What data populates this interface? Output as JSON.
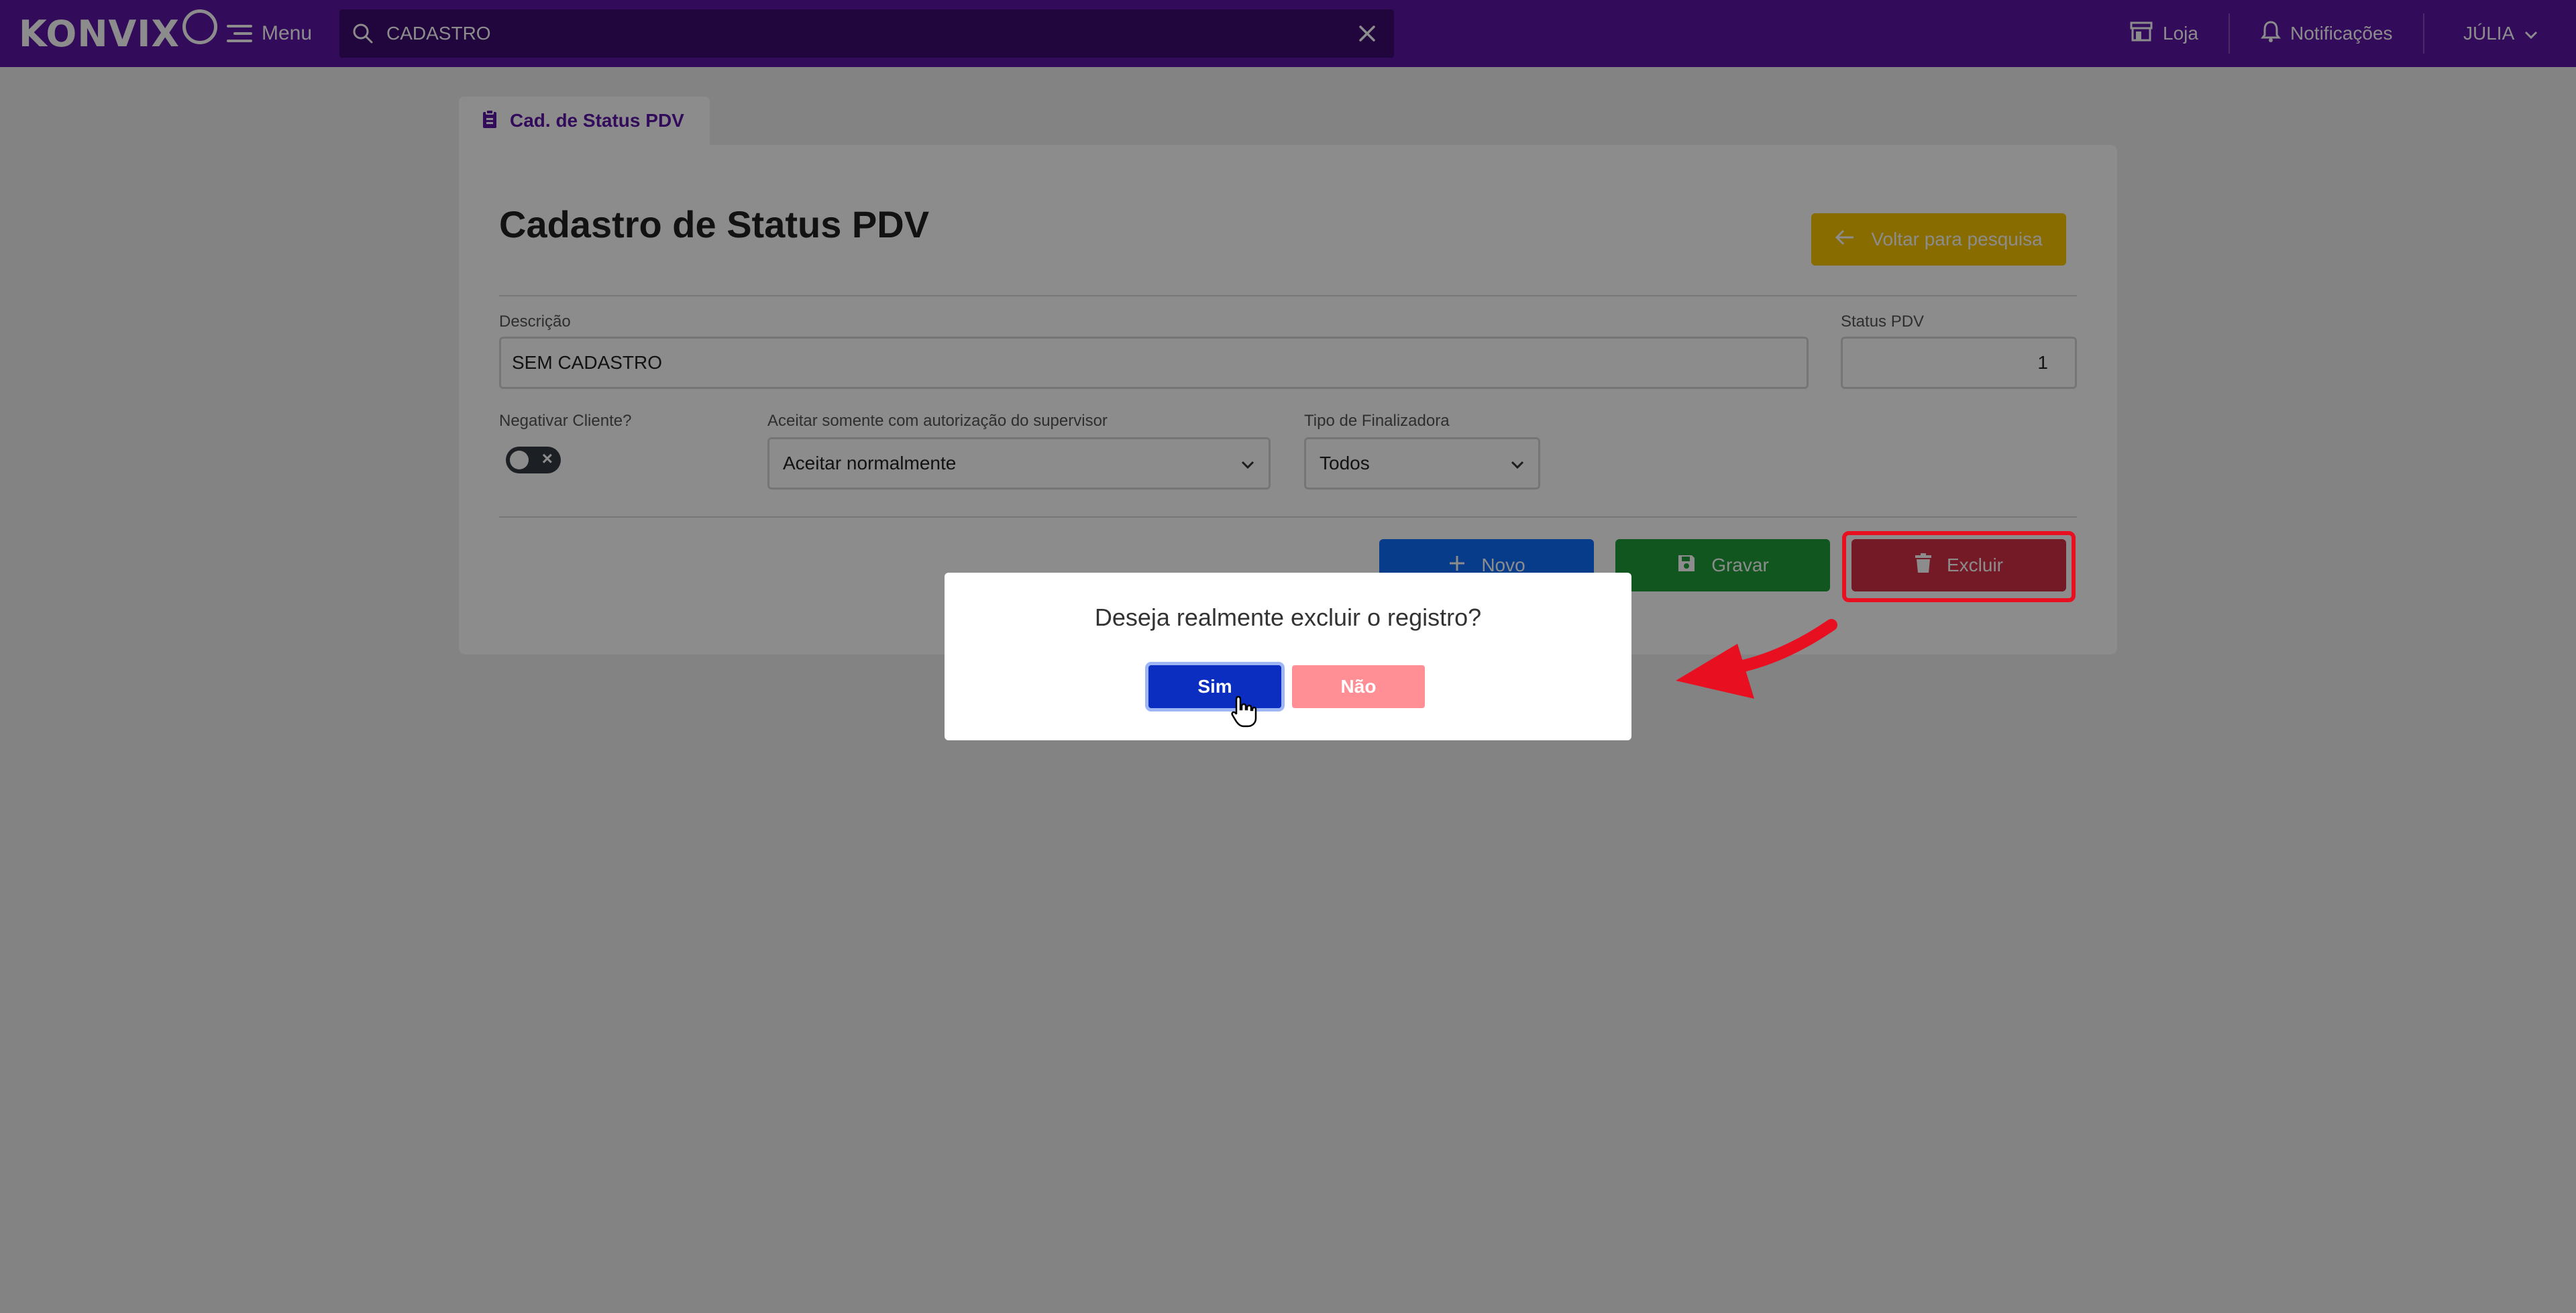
{
  "app": {
    "brand": "KONVIX"
  },
  "topbar": {
    "menu_label": "Menu",
    "search_value": "CADASTRO",
    "store_label": "Loja",
    "notifications_label": "Notificações",
    "user_label": "JÚLIA"
  },
  "tab": {
    "label": "Cad. de Status PDV"
  },
  "page": {
    "title": "Cadastro de Status PDV",
    "back_button": "Voltar para pesquisa"
  },
  "form": {
    "descricao": {
      "label": "Descrição",
      "value": "SEM CADASTRO"
    },
    "status_pdv": {
      "label": "Status PDV",
      "value": "1"
    },
    "negativar": {
      "label": "Negativar Cliente?",
      "enabled": false
    },
    "autorizacao": {
      "label": "Aceitar somente com autorização do supervisor",
      "value": "Aceitar normalmente"
    },
    "finalizadora": {
      "label": "Tipo de Finalizadora",
      "value": "Todos"
    }
  },
  "actions": {
    "novo": "Novo",
    "gravar": "Gravar",
    "excluir": "Excluir"
  },
  "dialog": {
    "message": "Deseja realmente excluir o registro?",
    "yes": "Sim",
    "no": "Não"
  },
  "colors": {
    "topbar": "#5b14a5",
    "search_bg": "#3d0c6f",
    "back_button": "#f8c500",
    "novo": "#0d6efd",
    "gravar": "#1f9d3a",
    "excluir": "#d32f45",
    "yes": "#0b2dc0",
    "no": "#ff8f95",
    "annotation": "#e81020"
  }
}
